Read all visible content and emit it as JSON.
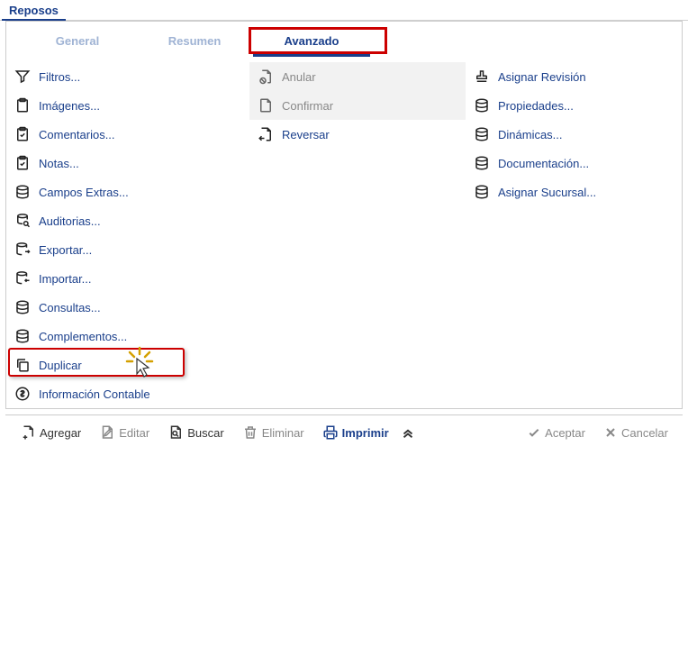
{
  "header": {
    "title": "Reposos"
  },
  "tabs": {
    "general": "General",
    "resumen": "Resumen",
    "avanzado": "Avanzado",
    "active": "avanzado"
  },
  "menu": {
    "col1": [
      {
        "label": "Filtros...",
        "icon": "filter"
      },
      {
        "label": "Imágenes...",
        "icon": "clipboard"
      },
      {
        "label": "Comentarios...",
        "icon": "clipboard-check"
      },
      {
        "label": "Notas...",
        "icon": "clipboard-check"
      },
      {
        "label": "Campos Extras...",
        "icon": "db"
      },
      {
        "label": "Auditorias...",
        "icon": "db-search"
      },
      {
        "label": "Exportar...",
        "icon": "db-out"
      },
      {
        "label": "Importar...",
        "icon": "db-in"
      },
      {
        "label": "Consultas...",
        "icon": "db"
      },
      {
        "label": "Complementos...",
        "icon": "db"
      },
      {
        "label": "Duplicar",
        "icon": "copy",
        "highlight": true
      },
      {
        "label": "Información Contable",
        "icon": "dollar"
      }
    ],
    "col2": [
      {
        "label": "Anular",
        "icon": "page-cancel",
        "disabled": true
      },
      {
        "label": "Confirmar",
        "icon": "page",
        "disabled": true
      },
      {
        "label": "Reversar",
        "icon": "page-back"
      }
    ],
    "col3": [
      {
        "label": "Asignar Revisión",
        "icon": "stamp"
      },
      {
        "label": "Propiedades...",
        "icon": "db"
      },
      {
        "label": "Dinámicas...",
        "icon": "db"
      },
      {
        "label": "Documentación...",
        "icon": "db"
      },
      {
        "label": "Asignar Sucursal...",
        "icon": "db"
      }
    ]
  },
  "toolbar": {
    "agregar": "Agregar",
    "editar": "Editar",
    "buscar": "Buscar",
    "eliminar": "Eliminar",
    "imprimir": "Imprimir",
    "aceptar": "Aceptar",
    "cancelar": "Cancelar"
  }
}
